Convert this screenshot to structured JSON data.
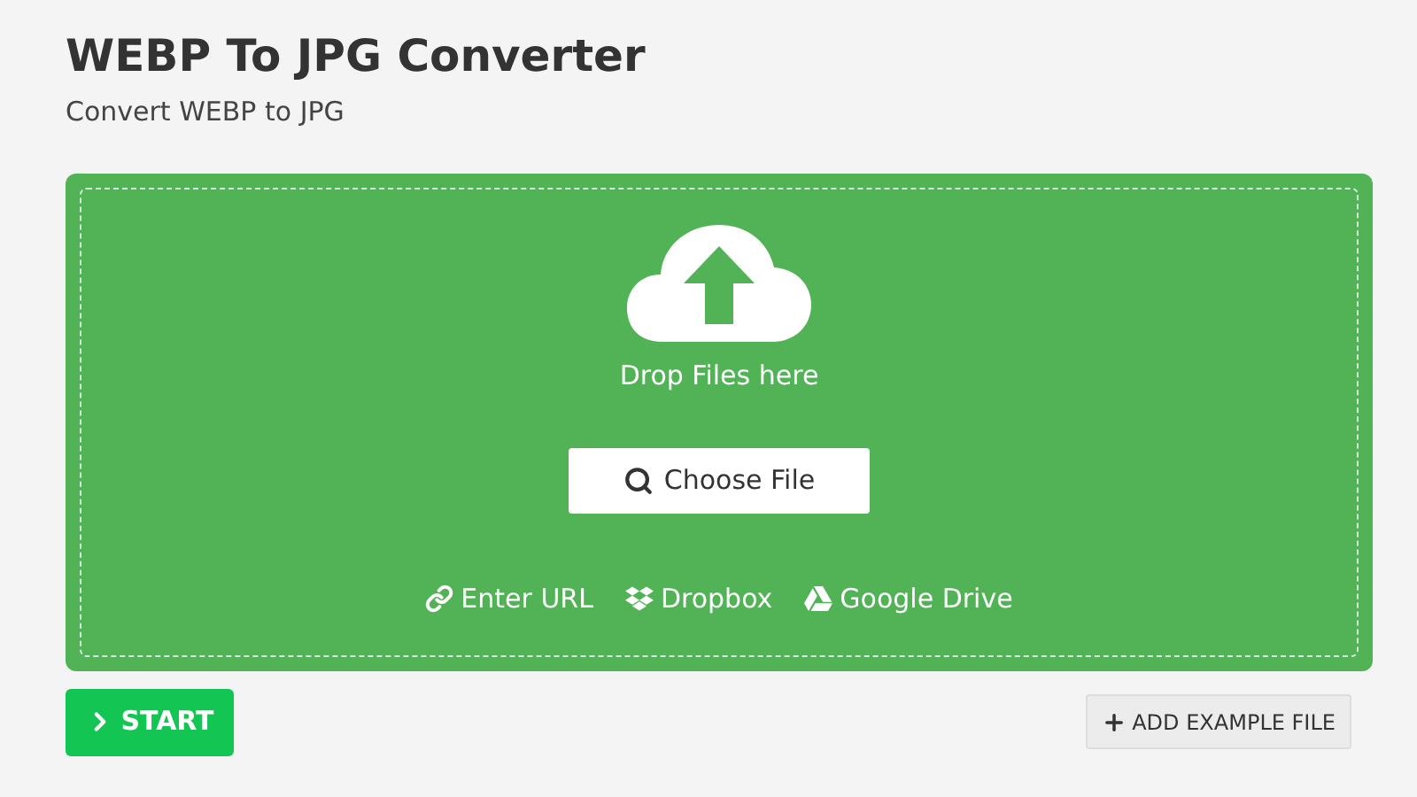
{
  "title": "WEBP To JPG Converter",
  "subtitle": "Convert WEBP to JPG",
  "dropzone": {
    "prompt": "Drop Files here",
    "choose_button": "Choose File",
    "sources": [
      {
        "kind": "url",
        "label": "Enter URL"
      },
      {
        "kind": "dropbox",
        "label": "Dropbox"
      },
      {
        "kind": "drive",
        "label": "Google Drive"
      }
    ]
  },
  "start_button": "START",
  "example_button": "ADD EXAMPLE FILE"
}
